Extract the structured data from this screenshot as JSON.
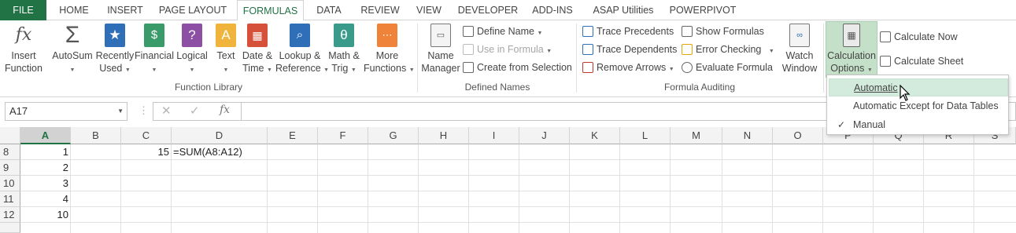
{
  "tabs": {
    "file": "FILE",
    "home": "HOME",
    "insert": "INSERT",
    "page_layout": "PAGE LAYOUT",
    "formulas": "FORMULAS",
    "data": "DATA",
    "review": "REVIEW",
    "view": "VIEW",
    "developer": "DEVELOPER",
    "addins": "ADD-INS",
    "asap": "ASAP Utilities",
    "powerpivot": "POWERPIVOT"
  },
  "ribbon": {
    "insert_function": [
      "Insert",
      "Function"
    ],
    "autosum": "AutoSum",
    "recently_used": [
      "Recently",
      "Used"
    ],
    "financial": "Financial",
    "logical": "Logical",
    "text": "Text",
    "date_time": [
      "Date &",
      "Time"
    ],
    "lookup_reference": [
      "Lookup &",
      "Reference"
    ],
    "math_trig": [
      "Math &",
      "Trig"
    ],
    "more_functions": [
      "More",
      "Functions"
    ],
    "function_library_label": "Function Library",
    "name_manager": [
      "Name",
      "Manager"
    ],
    "define_name": "Define Name",
    "use_in_formula": "Use in Formula",
    "create_from_selection": "Create from Selection",
    "defined_names_label": "Defined Names",
    "trace_precedents": "Trace Precedents",
    "trace_dependents": "Trace Dependents",
    "remove_arrows": "Remove Arrows",
    "show_formulas": "Show Formulas",
    "error_checking": "Error Checking",
    "evaluate_formula": "Evaluate Formula",
    "formula_auditing_label": "Formula Auditing",
    "watch_window": [
      "Watch",
      "Window"
    ],
    "calculation_options": [
      "Calculation",
      "Options"
    ],
    "calculate_now": "Calculate Now",
    "calculate_sheet": "Calculate Sheet"
  },
  "formula_bar": {
    "name_box": "A17",
    "cancel_glyph": "✕",
    "enter_glyph": "✓",
    "fx_glyph": "fx",
    "formula": ""
  },
  "grid": {
    "columns": [
      "A",
      "B",
      "C",
      "D",
      "E",
      "F",
      "G",
      "H",
      "I",
      "J",
      "K",
      "L",
      "M",
      "N",
      "O",
      "P",
      "Q",
      "R",
      "S"
    ],
    "selected_column": "A",
    "rows": [
      "8",
      "9",
      "10",
      "11",
      "12"
    ],
    "cells": {
      "a8": "1",
      "a9": "2",
      "a10": "3",
      "a11": "4",
      "a12": "10",
      "c8": "15",
      "d8": "=SUM(A8:A12)"
    }
  },
  "calc_menu": {
    "items": [
      "Automatic",
      "Automatic Except for Data Tables",
      "Manual"
    ],
    "hovered": "Automatic",
    "checked": "Manual",
    "check_glyph": "✓"
  },
  "colors": {
    "accent": "#217346",
    "hover_bg": "#d3ebdd",
    "active_button_bg": "#c5e0c9"
  }
}
